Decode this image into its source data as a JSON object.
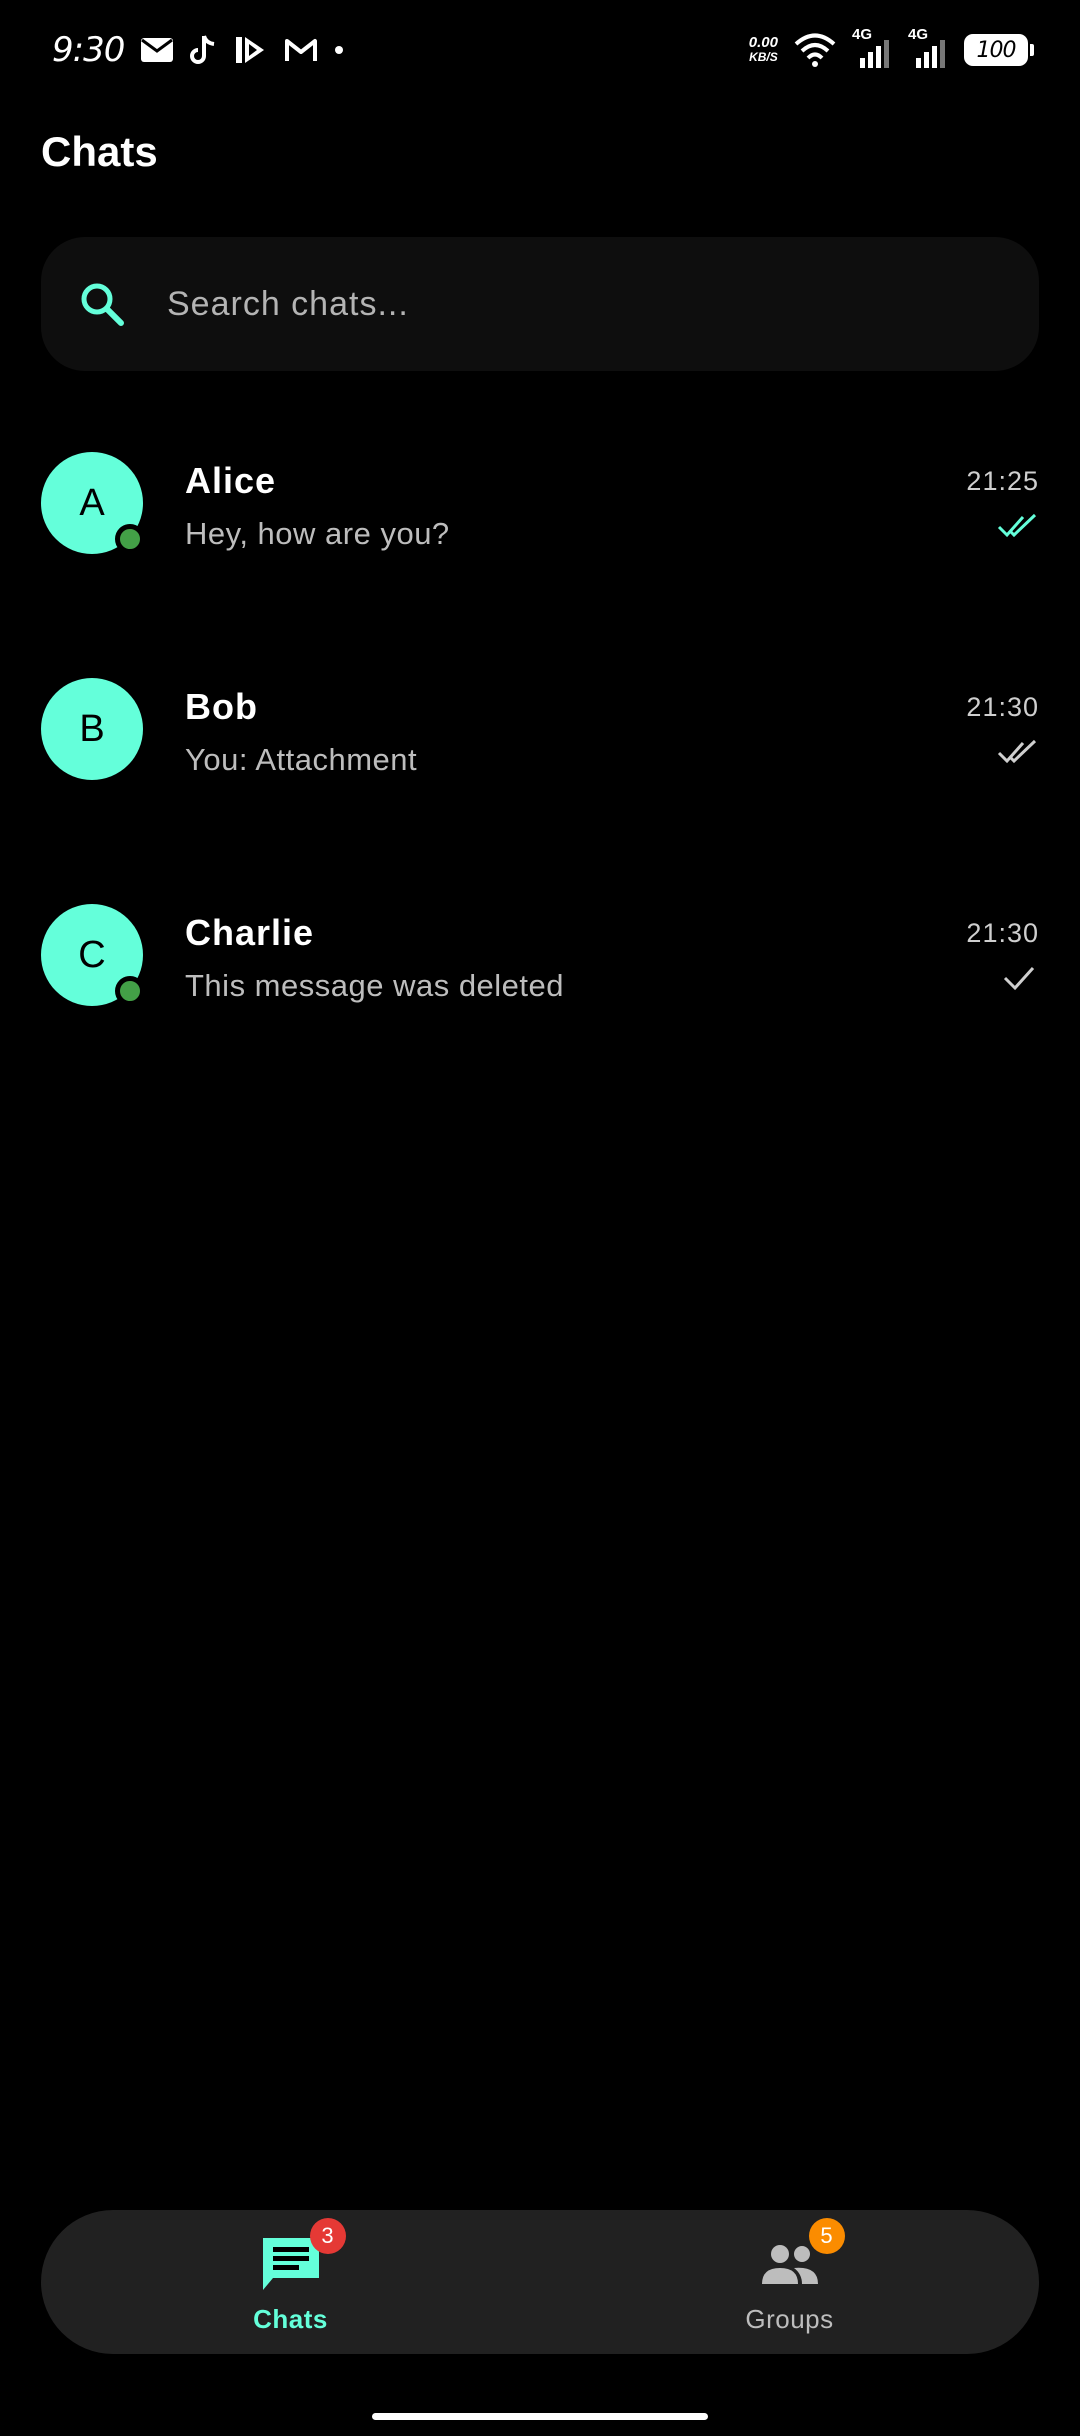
{
  "status_bar": {
    "time": "9:30",
    "net_speed_value": "0.00",
    "net_speed_unit": "KB/S",
    "network_1": "4G",
    "network_2": "4G",
    "battery": "100"
  },
  "header": {
    "title": "Chats"
  },
  "search": {
    "placeholder": "Search chats..."
  },
  "chats": [
    {
      "initial": "A",
      "name": "Alice",
      "preview": "Hey, how are you?",
      "time": "21:25",
      "receipt": "double-check-read-icon",
      "online": true
    },
    {
      "initial": "B",
      "name": "Bob",
      "preview": "You: Attachment",
      "time": "21:30",
      "receipt": "double-check-icon",
      "online": false
    },
    {
      "initial": "C",
      "name": "Charlie",
      "preview": "This message was deleted",
      "time": "21:30",
      "receipt": "single-check-icon",
      "online": true
    }
  ],
  "bottom_nav": [
    {
      "label": "Chats",
      "badge": "3",
      "active": true,
      "icon": "chat-icon"
    },
    {
      "label": "Groups",
      "badge": "5",
      "active": false,
      "icon": "group-icon"
    }
  ],
  "colors": {
    "accent": "#64ffda",
    "background": "#000000",
    "surface": "#212121",
    "online": "#43a047",
    "badge_red": "#e53935",
    "badge_orange": "#fb8c00"
  }
}
